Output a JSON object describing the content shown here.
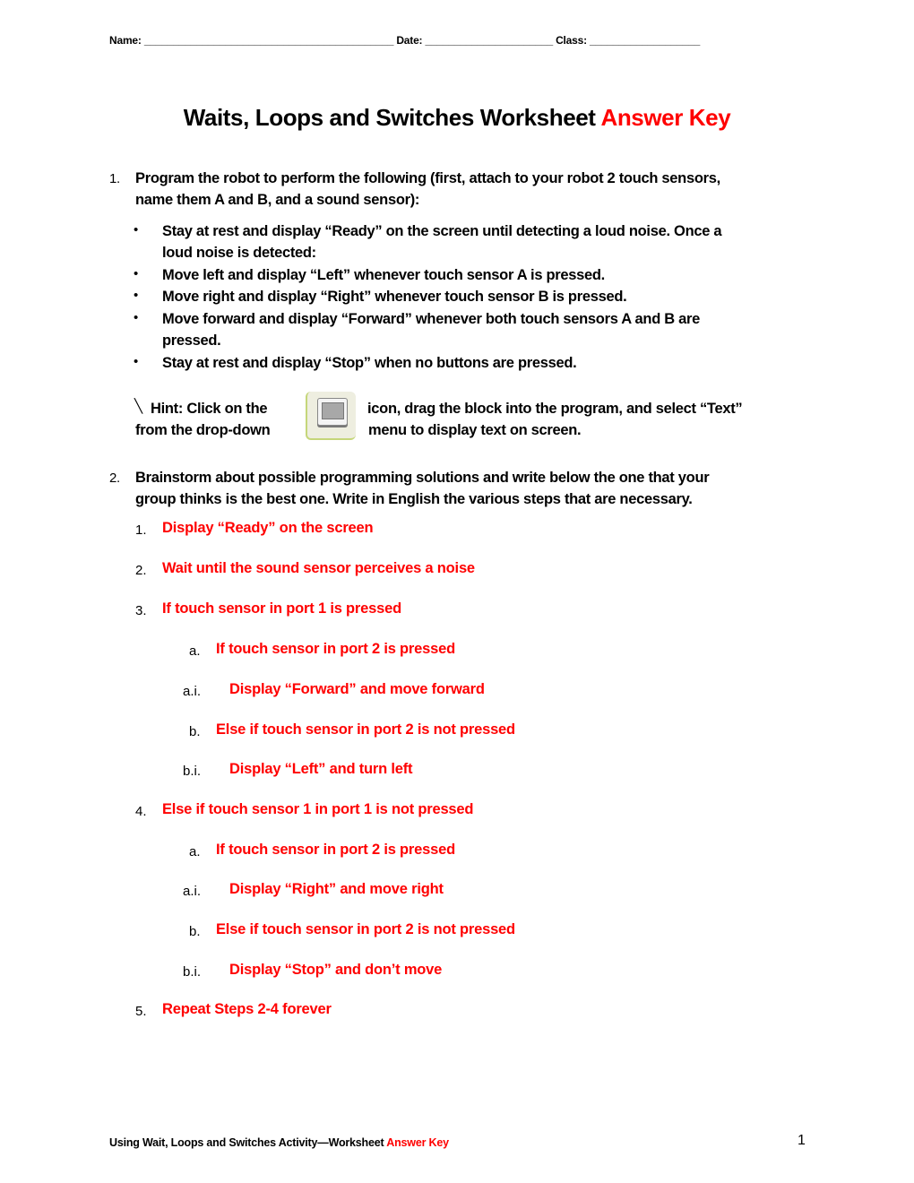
{
  "header": {
    "name_label": "Name:",
    "name_blank": "___________________________________________",
    "date_label": "Date:",
    "date_blank": "______________________",
    "class_label": "Class:",
    "class_blank": "___________________"
  },
  "title": {
    "main": "Waits, Loops and Switches Worksheet",
    "highlight": "Answer Key"
  },
  "question1": {
    "number": "1.",
    "line1": "Program the robot to perform the following (first, attach to your robot 2 touch sensors,",
    "line2": "name them A and B, and a sound sensor):",
    "bullets": [
      {
        "line1": "Stay at rest and display “Ready” on the screen until detecting a loud noise. Once a",
        "line2": "loud noise is detected:"
      },
      {
        "line1": "Move left and display “Left” whenever touch sensor A is pressed.",
        "line2": ""
      },
      {
        "line1": "Move right and display “Right” whenever touch sensor B is pressed.",
        "line2": ""
      },
      {
        "line1": "Move forward and display “Forward” whenever both touch sensors A and B are",
        "line2": "pressed."
      },
      {
        "line1": "Stay at rest and display “Stop” when no buttons are pressed.",
        "line2": ""
      }
    ],
    "hint": {
      "mark": "╲",
      "left_line1": "Hint: Click on the",
      "left_line2": "from the drop-down",
      "right_line1": "icon, drag the block into the program, and select “Text”",
      "right_line2": "menu to display text on screen.",
      "icon": "display-block-icon"
    }
  },
  "question2": {
    "number": "2.",
    "line1": "Brainstorm about possible programming solutions and write below the one that your",
    "line2": "group thinks is the best one. Write in English the various steps that are necessary.",
    "steps": [
      {
        "label": "1.",
        "text": "Display “Ready” on the screen"
      },
      {
        "label": "2.",
        "text": "Wait until the sound sensor perceives a noise"
      },
      {
        "label": "3.",
        "text": "If touch sensor in port 1 is pressed"
      },
      {
        "label": "a.",
        "text": "If touch sensor in port 2 is pressed"
      },
      {
        "label": "a.i.",
        "text": "Display “Forward” and move forward"
      },
      {
        "label": "b.",
        "text": "Else if touch sensor in port 2 is not pressed"
      },
      {
        "label": "b.i.",
        "text": "Display “Left” and turn left"
      },
      {
        "label": "4.",
        "text": "Else if touch sensor 1 in port 1 is not pressed"
      },
      {
        "label": "a.",
        "text": "If touch sensor in port 2 is pressed"
      },
      {
        "label": "a.i.",
        "text": "Display “Right” and move right"
      },
      {
        "label": "b.",
        "text": "Else if touch sensor in port 2 is not pressed"
      },
      {
        "label": "b.i.",
        "text": "Display “Stop” and don’t move"
      },
      {
        "label": "5.",
        "text": "Repeat Steps 2-4 forever"
      }
    ]
  },
  "footer": {
    "text": "Using Wait, Loops and Switches Activity—Worksheet",
    "highlight": "Answer Key",
    "page_number": "1"
  },
  "colors": {
    "answer": "#ff0000",
    "text": "#000000"
  }
}
